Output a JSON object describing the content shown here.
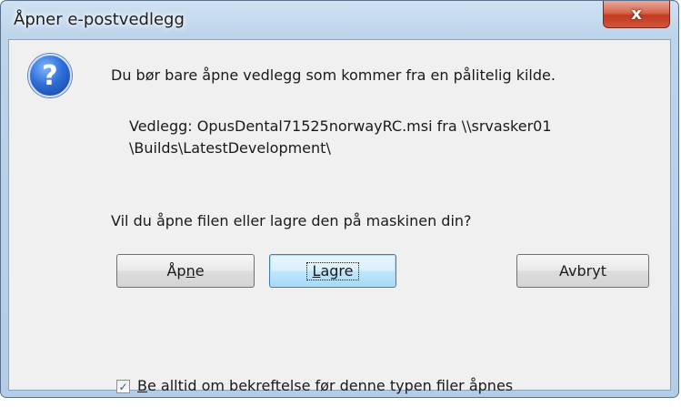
{
  "window": {
    "title": "Åpner e-postvedlegg",
    "close_label": "x"
  },
  "message": {
    "warning": "Du bør bare åpne vedlegg som kommer fra en pålitelig kilde.",
    "attachment_line1": "Vedlegg: OpusDental71525norwayRC.msi fra \\\\srvasker01",
    "attachment_line2": "\\Builds\\LatestDevelopment\\",
    "question": "Vil du åpne filen eller lagre den på maskinen din?"
  },
  "icon": {
    "name": "question-icon",
    "glyph": "?"
  },
  "buttons": {
    "open_pre": "Åp",
    "open_mnemonic": "n",
    "open_post": "e",
    "save_mnemonic": "L",
    "save_post": "agre",
    "cancel": "Avbryt"
  },
  "checkbox": {
    "checked": true,
    "mark": "✓",
    "label_mnemonic": "B",
    "label_post": "e alltid om bekreftelse før denne typen filer åpnes"
  }
}
